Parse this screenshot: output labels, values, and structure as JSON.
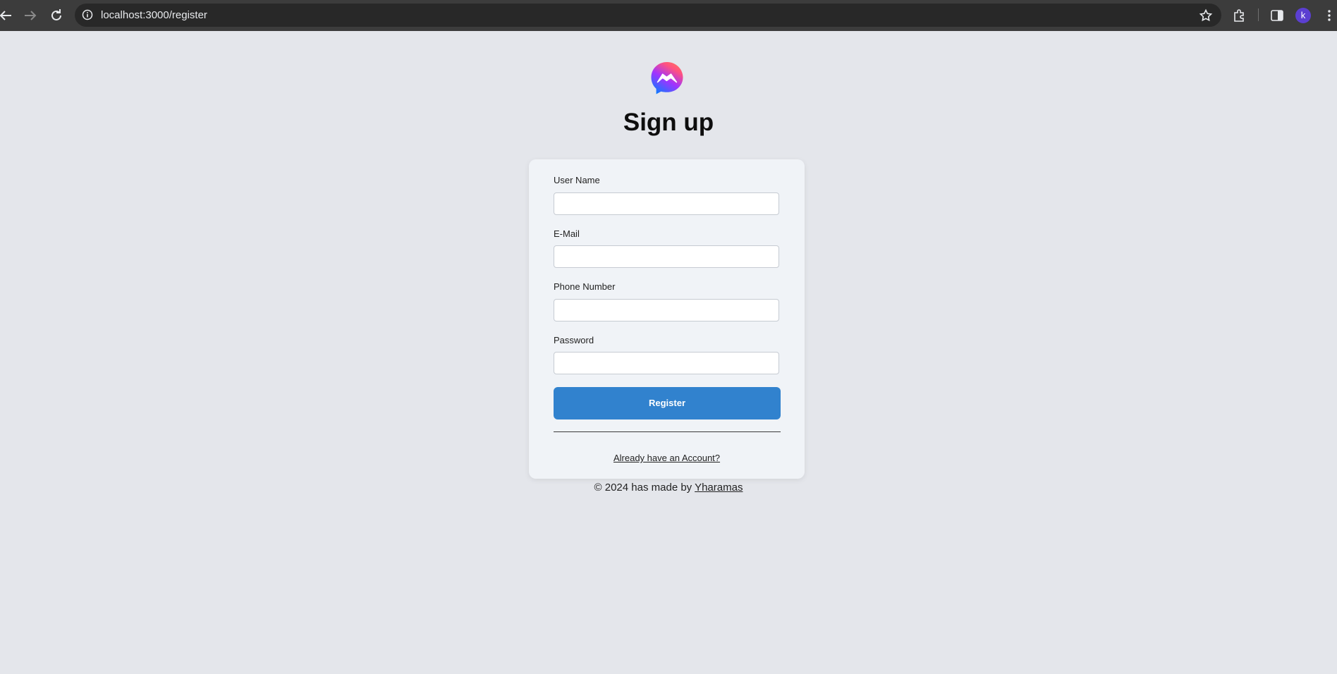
{
  "browser": {
    "url": "localhost:3000/register",
    "profile_initial": "k",
    "icons": [
      "back-arrow-icon",
      "forward-arrow-icon",
      "reload-icon",
      "site-info-icon",
      "bookmark-star-icon",
      "extensions-icon",
      "side-panel-icon",
      "more-menu-icon"
    ]
  },
  "page": {
    "logo_icon": "messenger-logo-icon",
    "title": "Sign up"
  },
  "form": {
    "fields": [
      {
        "label": "User Name",
        "value": ""
      },
      {
        "label": "E-Mail",
        "value": ""
      },
      {
        "label": "Phone Number",
        "value": ""
      },
      {
        "label": "Password",
        "value": ""
      }
    ],
    "submit_label": "Register",
    "account_link": "Already have an Account?"
  },
  "footer": {
    "text": "© 2024 has made by",
    "author": "Yharamas"
  },
  "colors": {
    "background": "#e4e6eb",
    "card": "#f0f3f7",
    "accent": "#3182ce"
  }
}
